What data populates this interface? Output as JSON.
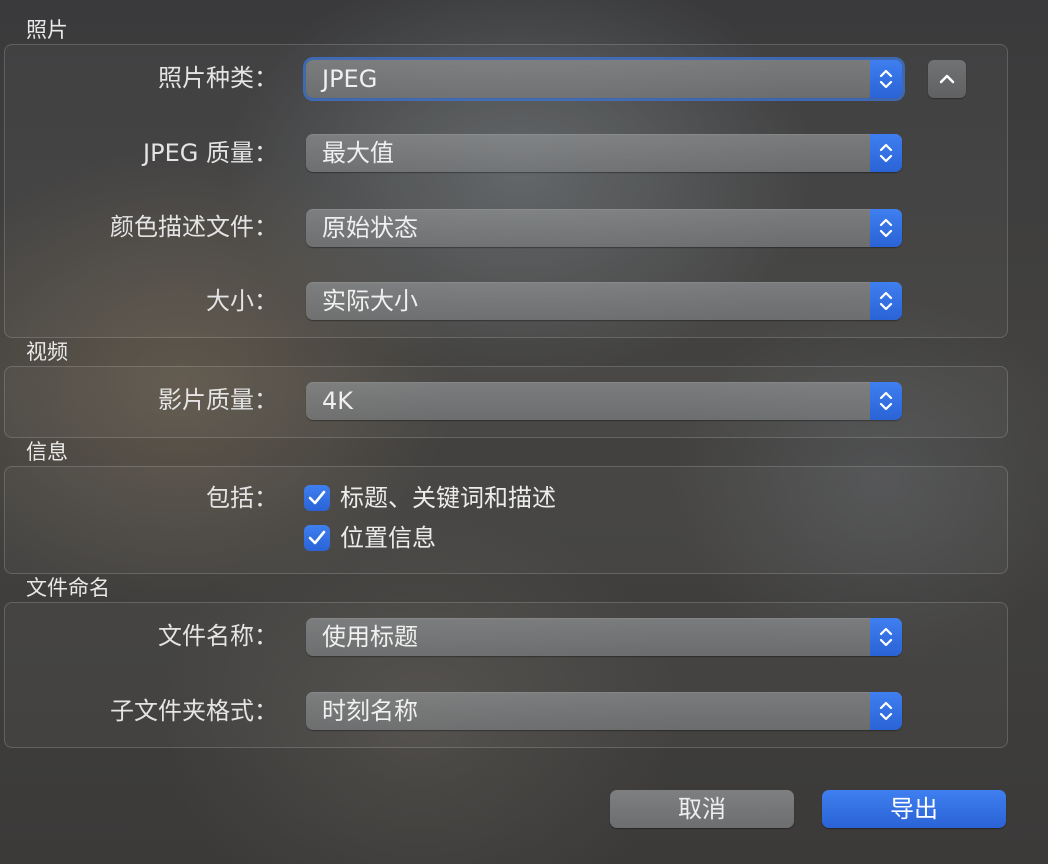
{
  "photos": {
    "section_title": "照片",
    "photo_kind": {
      "label": "照片种类：",
      "value": "JPEG"
    },
    "jpeg_quality": {
      "label": "JPEG 质量：",
      "value": "最大值"
    },
    "color_profile": {
      "label": "颜色描述文件：",
      "value": "原始状态"
    },
    "size": {
      "label": "大小：",
      "value": "实际大小"
    }
  },
  "video": {
    "section_title": "视频",
    "movie_quality": {
      "label": "影片质量：",
      "value": "4K"
    }
  },
  "info": {
    "section_title": "信息",
    "include_label": "包括：",
    "checkboxes": [
      {
        "label": "标题、关键词和描述",
        "checked": true
      },
      {
        "label": "位置信息",
        "checked": true
      }
    ]
  },
  "file_naming": {
    "section_title": "文件命名",
    "file_name": {
      "label": "文件名称：",
      "value": "使用标题"
    },
    "subfolder_format": {
      "label": "子文件夹格式：",
      "value": "时刻名称"
    }
  },
  "buttons": {
    "cancel": "取消",
    "export": "导出"
  },
  "colors": {
    "accent": "#2f6fe4",
    "control": "#7c7e80"
  },
  "icons": {
    "popup": "up-down-chevron-icon",
    "disclosure": "chevron-up-icon",
    "check": "checkmark-icon"
  }
}
